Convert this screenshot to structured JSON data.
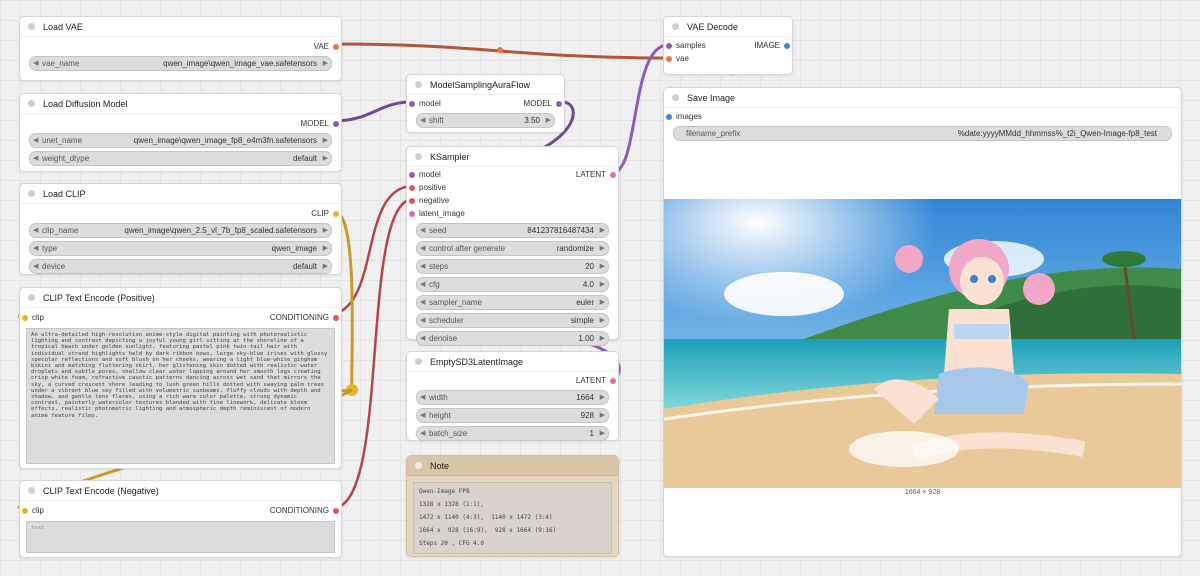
{
  "nodes": {
    "load_vae": {
      "title": "Load VAE",
      "output": "VAE",
      "widget_label": "vae_name",
      "widget_value": "qwen_image\\qwen_image_vae.safetensors"
    },
    "load_diffusion": {
      "title": "Load Diffusion Model",
      "output": "MODEL",
      "widgets": [
        {
          "label": "unet_name",
          "value": "qwen_image\\qwen_image_fp8_e4m3fn.safetensors"
        },
        {
          "label": "weight_dtype",
          "value": "default"
        }
      ]
    },
    "load_clip": {
      "title": "Load CLIP",
      "output": "CLIP",
      "widgets": [
        {
          "label": "clip_name",
          "value": "qwen_image\\qwen_2.5_vl_7b_fp8_scaled.safetensors"
        },
        {
          "label": "type",
          "value": "qwen_image"
        },
        {
          "label": "device",
          "value": "default"
        }
      ]
    },
    "clip_pos": {
      "title": "CLIP Text Encode (Positive)",
      "input": "clip",
      "output": "CONDITIONING",
      "text": "An ultra-detailed high-resolution anime-style digital painting with photorealistic lighting and contrast depicting a joyful young girl sitting at the shoreline of a tropical beach under golden sunlight, featuring pastel pink twin-tail hair with individual strand highlights held by dark ribbon bows, large sky-blue irises with glossy specular reflections and soft blush on her cheeks, wearing a light blue-white gingham bikini and matching fluttering skirt, her glistening skin dotted with realistic water droplets and subtle pores, shallow clear water lapping around her smooth legs creating crisp white foam, refractive caustic patterns dancing across wet sand that mirrors the sky, a curved crescent shore leading to lush green hills dotted with swaying palm trees under a vibrant blue sky filled with volumetric sunbeams, fluffy clouds with depth and shadow, and gentle lens flares, using a rich warm color palette, strong dynamic contrast, painterly watercolor textures blended with fine linework, delicate bloom effects, realistic photometric lighting and atmospheric depth reminiscent of modern anime feature films."
    },
    "clip_neg": {
      "title": "CLIP Text Encode (Negative)",
      "input": "clip",
      "output": "CONDITIONING",
      "placeholder": "text"
    },
    "aura": {
      "title": "ModelSamplingAuraFlow",
      "input": "model",
      "output": "MODEL",
      "widget_label": "shift",
      "widget_value": "3.50"
    },
    "ksampler": {
      "title": "KSampler",
      "inputs": [
        "model",
        "positive",
        "negative",
        "latent_image"
      ],
      "output": "LATENT",
      "widgets": [
        {
          "label": "seed",
          "value": "841237816487434"
        },
        {
          "label": "control after generate",
          "value": "randomize"
        },
        {
          "label": "steps",
          "value": "20"
        },
        {
          "label": "cfg",
          "value": "4.0"
        },
        {
          "label": "sampler_name",
          "value": "euler"
        },
        {
          "label": "scheduler",
          "value": "simple"
        },
        {
          "label": "denoise",
          "value": "1.00"
        }
      ]
    },
    "latent": {
      "title": "EmptySD3LatentImage",
      "output": "LATENT",
      "widgets": [
        {
          "label": "width",
          "value": "1664"
        },
        {
          "label": "height",
          "value": "928"
        },
        {
          "label": "batch_size",
          "value": "1"
        }
      ]
    },
    "note": {
      "title": "Note",
      "lines": [
        "Qwen-Image FP8",
        "1328 x 1328 (1:1),",
        "1472 x 1140 (4:3),  1140 x 1472 (3:4)",
        "1664 x  928 (16:9),  928 x 1664 (9:16)",
        "Steps 20 , CFG 4.0"
      ]
    },
    "vae_decode": {
      "title": "VAE Decode",
      "inputs": [
        "samples",
        "vae"
      ],
      "output": "IMAGE"
    },
    "save_image": {
      "title": "Save Image",
      "input": "images",
      "widget_label": "filename_prefix",
      "widget_value": "%date:yyyyMMdd_hhmmss%_t2i_Qwen-Image-fp8_test",
      "caption": "1664 × 928"
    }
  },
  "colors": {
    "model": "#8e5cb5",
    "vae": "#e9763a",
    "clip": "#e5b52a",
    "conditioning": "#e0555a",
    "latent": "#d86fb4",
    "image": "#3d86c6"
  }
}
